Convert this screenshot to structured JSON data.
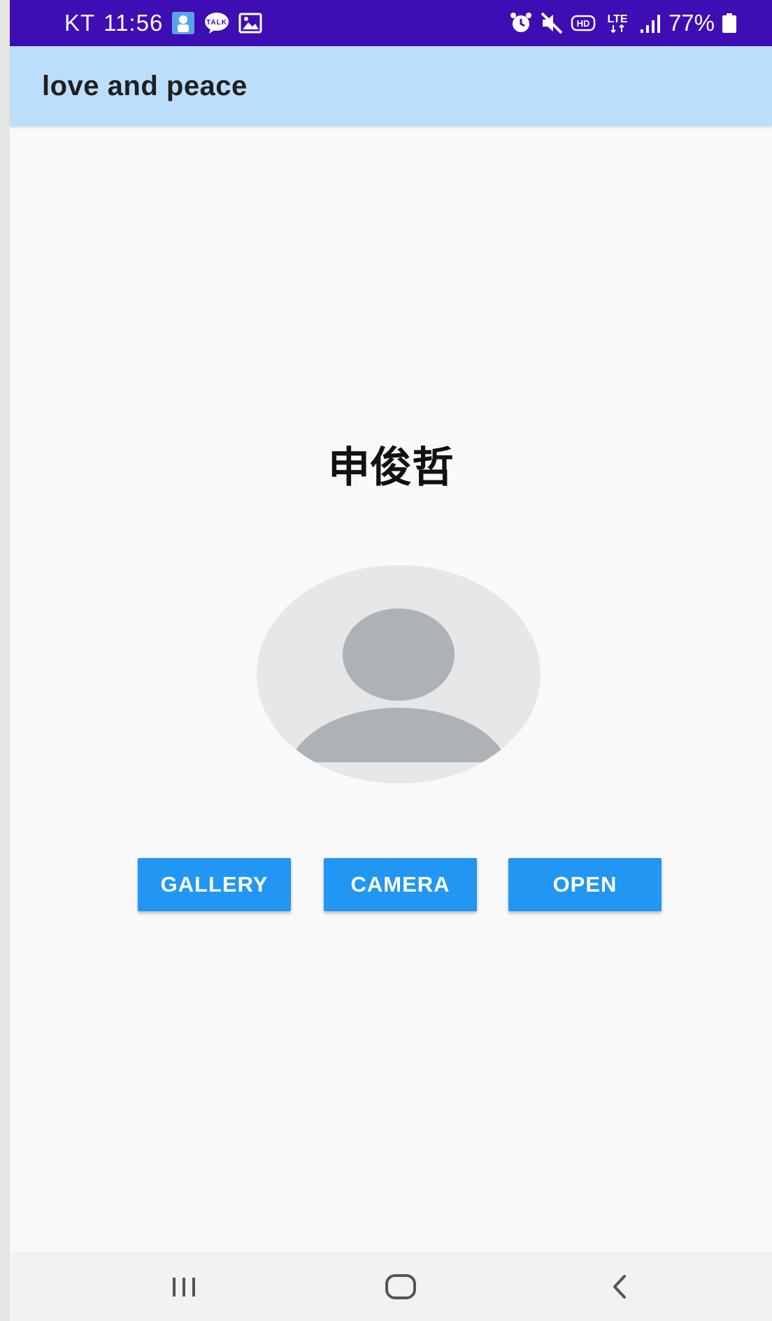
{
  "status_bar": {
    "carrier": "KT",
    "time": "11:56",
    "network_lte": "LTE",
    "network_hd": "HD",
    "battery": "77%"
  },
  "app_bar": {
    "title": "love and peace"
  },
  "profile": {
    "name": "申俊哲",
    "avatar_icon": "person-placeholder-icon"
  },
  "actions": {
    "gallery_label": "GALLERY",
    "camera_label": "CAMERA",
    "open_label": "OPEN"
  },
  "colors": {
    "status_bar": "#3e0db3",
    "app_bar": "#bbdefb",
    "button": "#2196f3",
    "avatar_bg": "#e6e7e9",
    "avatar_fg": "#adb2b7"
  },
  "nav_bar": {
    "icons": [
      "recents-icon",
      "home-icon",
      "back-icon"
    ]
  }
}
